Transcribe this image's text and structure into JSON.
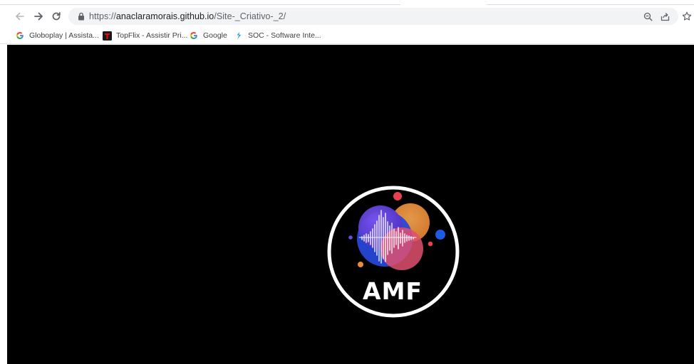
{
  "browser": {
    "address_bar": {
      "scheme": "https://",
      "host": "anaclaramorais.github.io",
      "path": "/Site-_Criativo-_2/"
    },
    "toolbar_icons": {
      "back": "arrow-left-icon",
      "forward": "arrow-right-icon",
      "reload": "reload-icon",
      "lock": "lock-icon",
      "zoom": "zoom-icon",
      "share": "share-icon",
      "bookmark": "star-icon"
    },
    "bookmarks": [
      {
        "label": "Globoplay | Assista...",
        "icon": "google-g-icon"
      },
      {
        "label": "TopFlix - Assistir Pri...",
        "icon": "topflix-icon"
      },
      {
        "label": "Google",
        "icon": "google-g-icon"
      },
      {
        "label": "SOC - Software Inte...",
        "icon": "soc-icon"
      }
    ]
  },
  "page": {
    "logo_text": "AMF",
    "background": "#000000",
    "logo_colors": {
      "ring": "#ffffff",
      "purple": "#5b3fd6",
      "blue": "#2647d8",
      "orange": "#e98a3c",
      "pink": "#e0506f",
      "dot_red": "#e8404f",
      "dot_blue": "#1d5ae8"
    }
  }
}
